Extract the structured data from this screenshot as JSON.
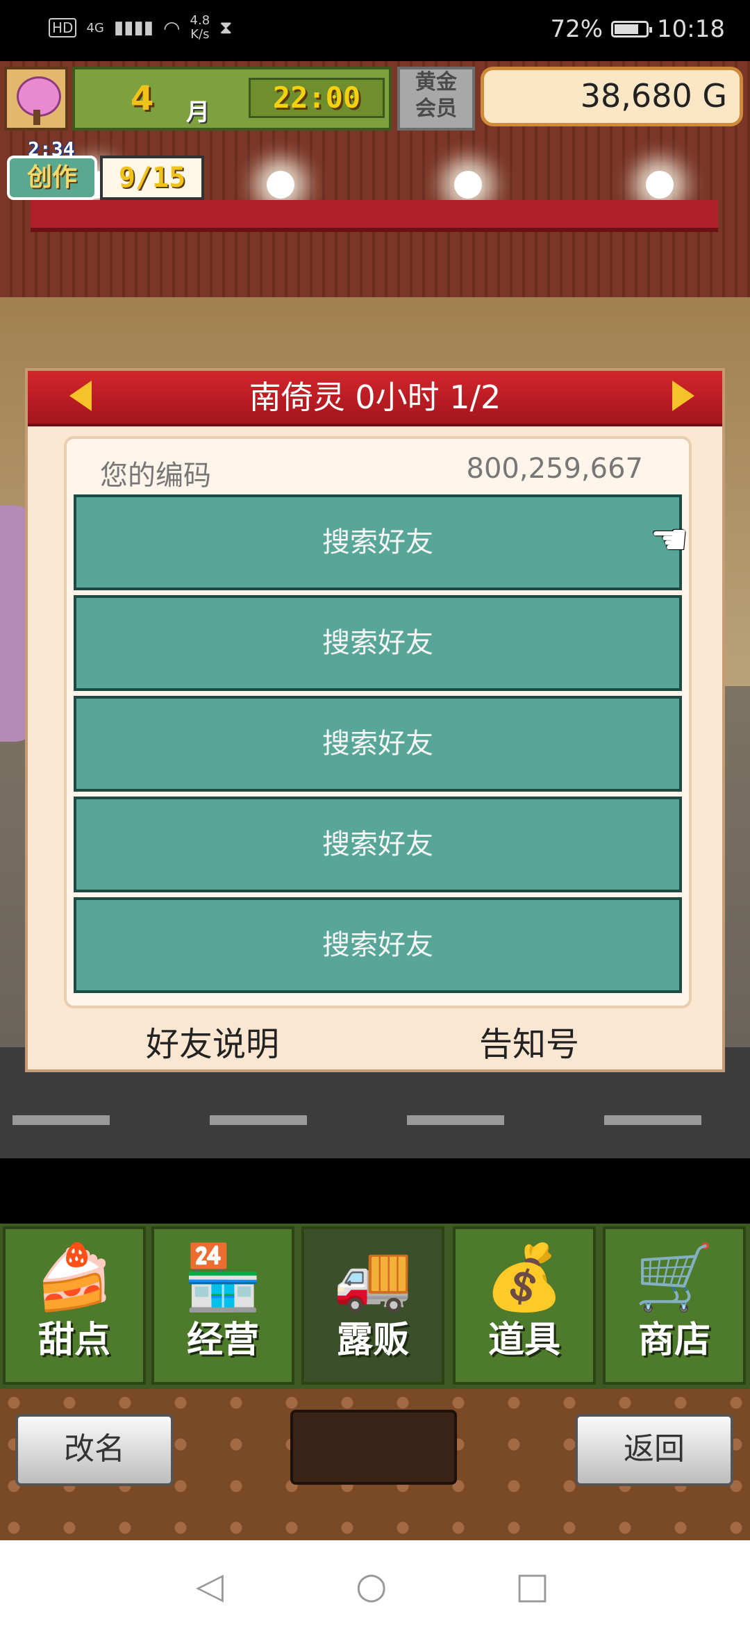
{
  "status_bar": {
    "hd": "HD",
    "network": "4G",
    "speed_value": "4.8",
    "speed_unit": "K/s",
    "battery": "72%",
    "time": "10:18"
  },
  "hud": {
    "month_number": "4",
    "month_label": "月",
    "time": "22:00",
    "gold_member_line1": "黄金",
    "gold_member_line2": "会员",
    "money": "38,680 G",
    "create_timer": "2:34",
    "create_label": "创作",
    "create_count": "9/15"
  },
  "modal": {
    "title": "南倚灵  0小时 1/2",
    "code_label": "您的编码",
    "code_value": "800,259,667",
    "friend_slots": [
      "搜索好友",
      "搜索好友",
      "搜索好友",
      "搜索好友",
      "搜索好友"
    ],
    "footer_left": "好友说明",
    "footer_right": "告知号"
  },
  "menu": {
    "tabs": [
      {
        "label": "甜点",
        "icon": "cake-icon",
        "glyph": "🍰"
      },
      {
        "label": "经营",
        "icon": "shop-icon",
        "glyph": "🏪"
      },
      {
        "label": "露贩",
        "icon": "food-truck-icon",
        "glyph": "🚚"
      },
      {
        "label": "道具",
        "icon": "items-bag-icon",
        "glyph": "💰"
      },
      {
        "label": "商店",
        "icon": "shopping-cart-icon",
        "glyph": "🛒"
      }
    ]
  },
  "actions": {
    "rename": "改名",
    "back": "返回"
  },
  "colors": {
    "modal_header": "#c0202a",
    "friend_slot": "#58a698",
    "menu_green": "#4e7a2c"
  }
}
